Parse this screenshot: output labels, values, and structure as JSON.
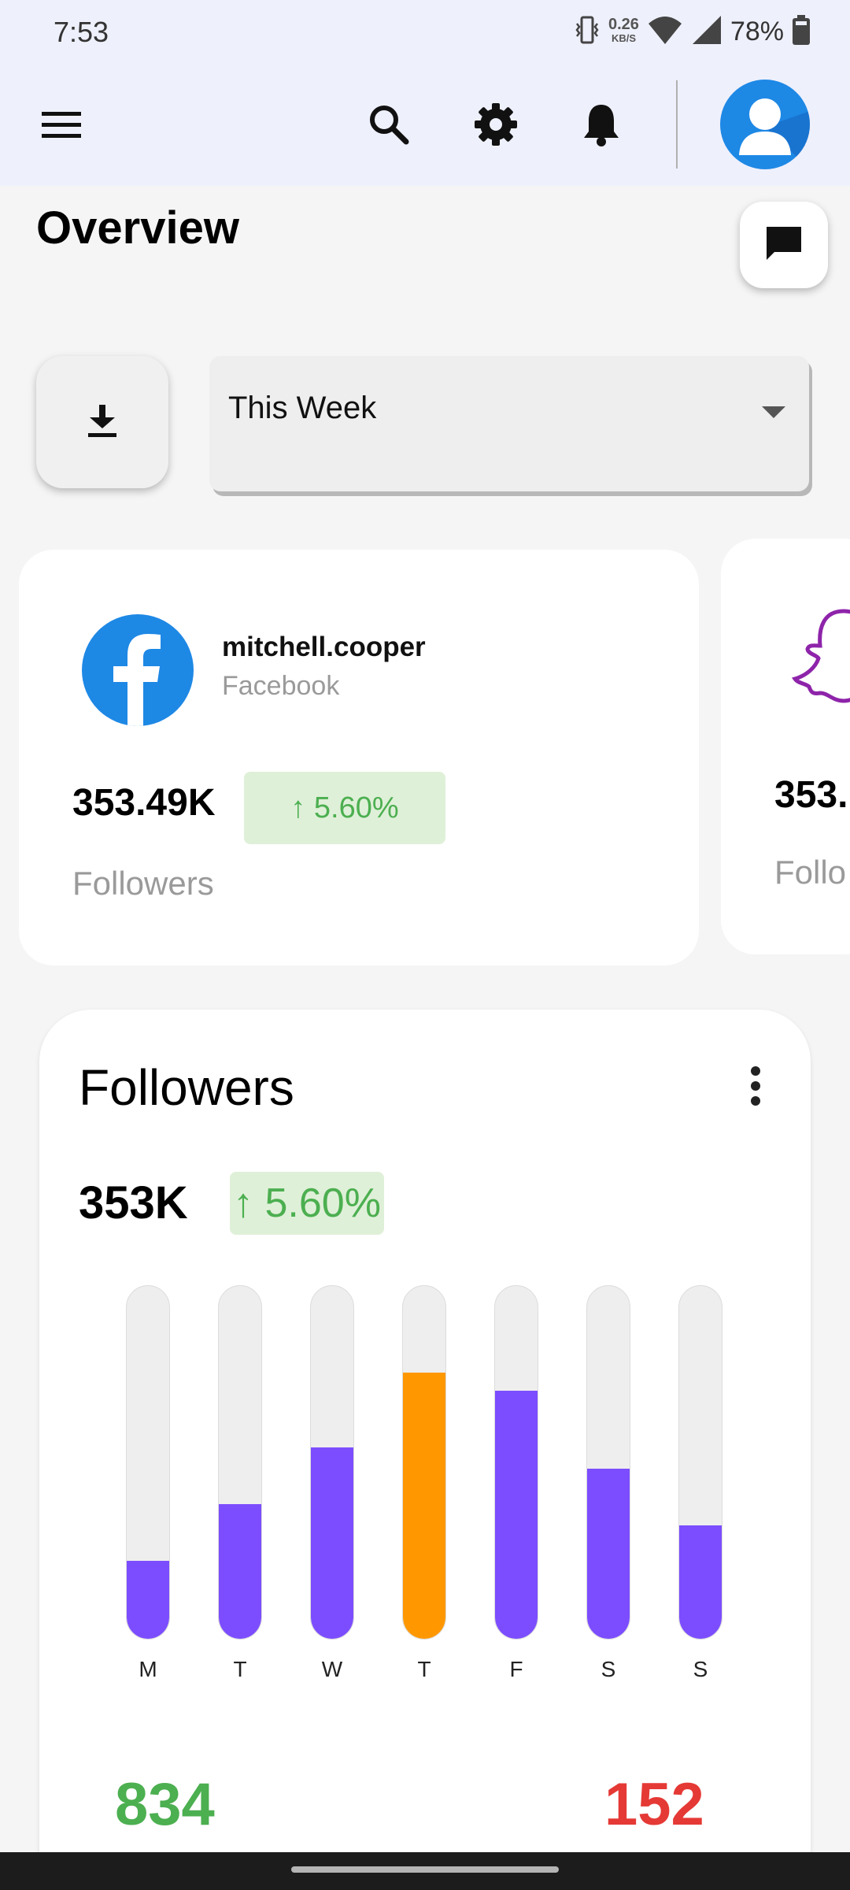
{
  "status_bar": {
    "time": "7:53",
    "net_speed_value": "0.26",
    "net_speed_unit": "KB/S",
    "battery_percent": "78%",
    "icons": [
      "vibrate-icon",
      "wifi-icon",
      "cellular-signal-icon",
      "battery-icon"
    ]
  },
  "app_bar": {
    "icons": [
      "menu-icon",
      "search-icon",
      "gear-icon",
      "bell-icon",
      "avatar-icon"
    ]
  },
  "overview": {
    "title": "Overview",
    "chat_icon": "chat-icon",
    "download_icon": "download-icon"
  },
  "period_select": {
    "value": "This Week"
  },
  "accounts": [
    {
      "username": "mitchell.cooper",
      "platform": "Facebook",
      "followers": "353.49K",
      "change": "↑ 5.60%",
      "label": "Followers",
      "icon": "facebook-icon",
      "brand_color": "#1e88e5"
    },
    {
      "followers": "353.",
      "label": "Follo",
      "icon": "snapchat-icon",
      "brand_color": "#8e24aa"
    }
  ],
  "followers_chart": {
    "title": "Followers",
    "total": "353K",
    "change": "↑ 5.60%",
    "stat_left": "834",
    "stat_right": "152",
    "colors": {
      "bar": "#7c4dff",
      "highlight": "#ff9800",
      "track": "#eeeeee",
      "up": "#4caf50",
      "down": "#e53935"
    }
  },
  "chart_data": {
    "type": "bar",
    "categories": [
      "M",
      "T",
      "W",
      "T",
      "F",
      "S",
      "S"
    ],
    "values": [
      0.22,
      0.38,
      0.54,
      0.75,
      0.7,
      0.48,
      0.32
    ],
    "highlight_index": 3,
    "ylim": [
      0,
      1
    ],
    "grid": false
  }
}
